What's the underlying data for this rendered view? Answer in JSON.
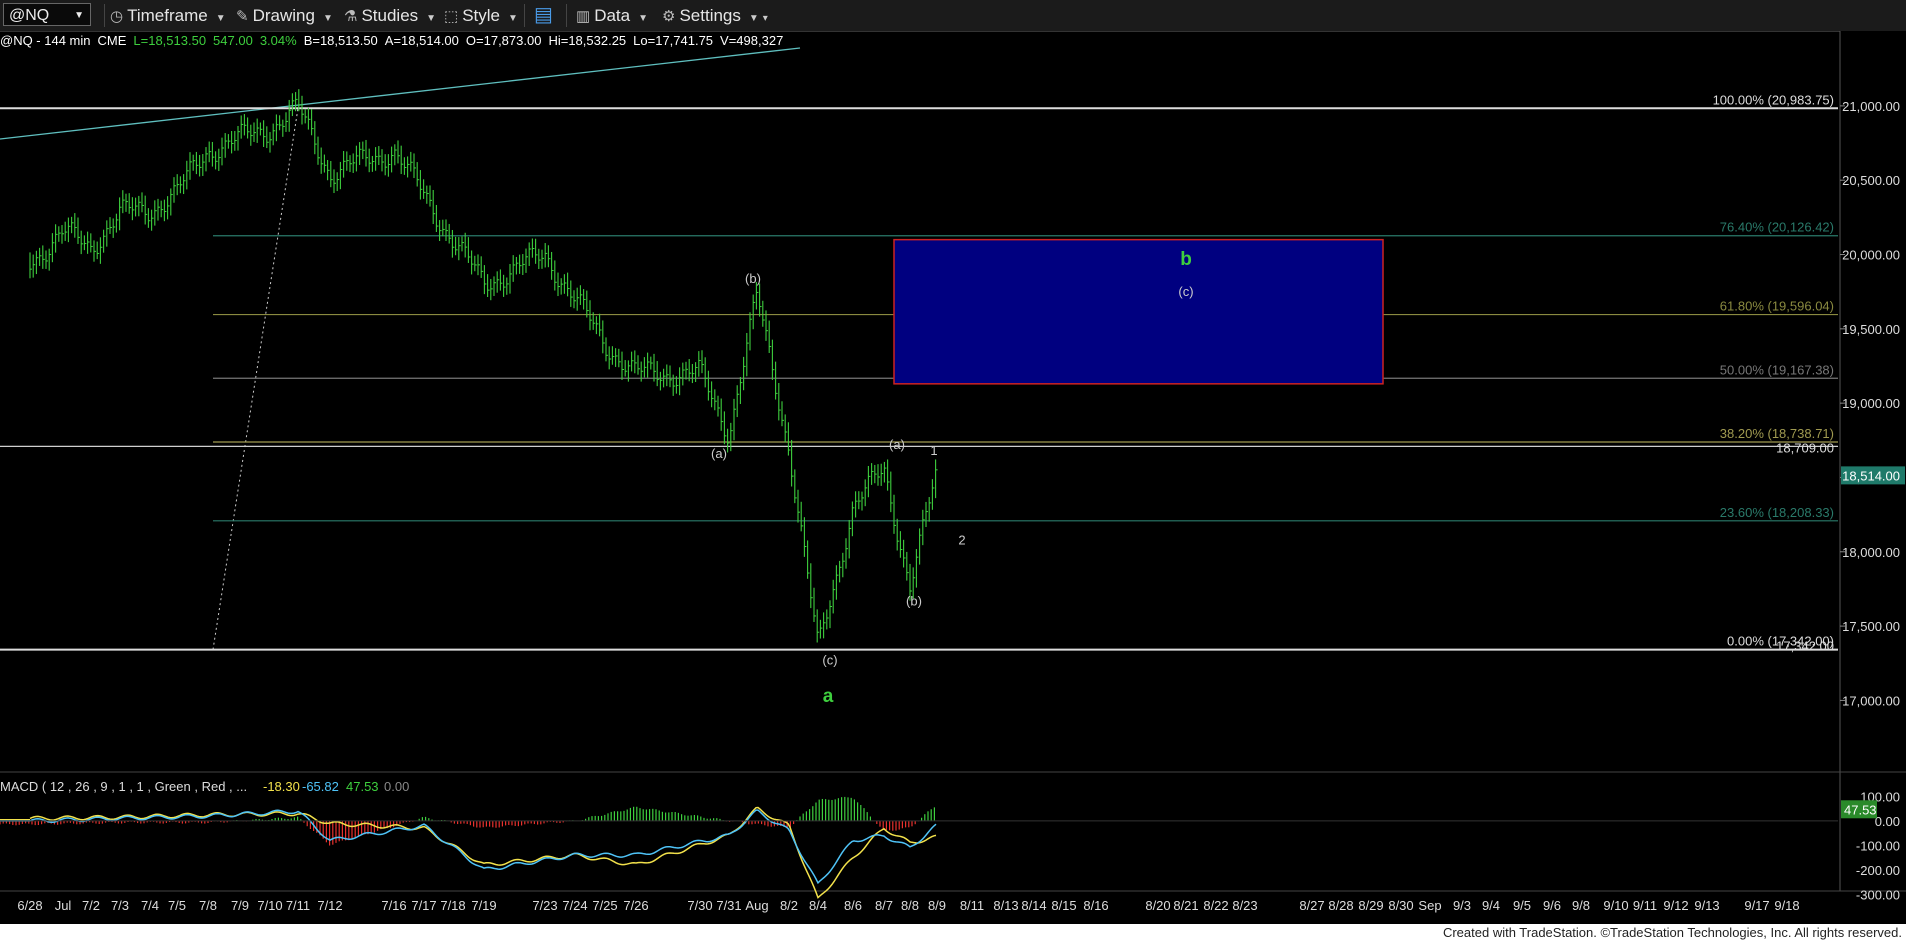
{
  "toolbar": {
    "symbol": "@NQ",
    "timeframe": "Timeframe",
    "drawing": "Drawing",
    "studies": "Studies",
    "style": "Style",
    "data": "Data",
    "settings": "Settings"
  },
  "info": {
    "symbol_line": "@NQ - 144 min",
    "exchange": "CME",
    "last": "L=18,513.50",
    "change": "547.00",
    "change_pct": "3.04%",
    "bid": "B=18,513.50",
    "ask": "A=18,514.00",
    "open": "O=17,873.00",
    "high": "Hi=18,532.25",
    "low": "Lo=17,741.75",
    "volume": "V=498,327"
  },
  "footer": "Created with TradeStation. ©TradeStation Technologies, Inc. All rights reserved.",
  "colors": {
    "up": "#3ecf3e",
    "down": "#e8312e",
    "macd_line": "#4fc3f7",
    "signal_line": "#f2e14b",
    "target_box": "#000080",
    "target_border": "#cc2222",
    "trendline": "#5fbfbf",
    "price_badge": "#1f7a6a"
  },
  "chart_data": [
    {
      "type": "candlestick",
      "timeframe": "144 min",
      "x_tick_labels": [
        "6/28",
        "Jul",
        "7/2",
        "7/3",
        "7/4",
        "7/5",
        "7/8",
        "7/9",
        "7/10",
        "7/11",
        "7/12",
        "7/16",
        "7/17",
        "7/18",
        "7/19",
        "7/23",
        "7/24",
        "7/25",
        "7/26",
        "7/30",
        "7/31",
        "Aug",
        "8/2",
        "8/4",
        "8/6",
        "8/7",
        "8/8",
        "8/9",
        "8/11",
        "8/13",
        "8/14",
        "8/15",
        "8/16",
        "8/20",
        "8/21",
        "8/22",
        "8/23",
        "8/27",
        "8/28",
        "8/29",
        "8/30",
        "Sep",
        "9/3",
        "9/4",
        "9/5",
        "9/6",
        "9/8",
        "9/10",
        "9/11",
        "9/12",
        "9/13",
        "9/17",
        "9/18"
      ],
      "ylim": [
        16700,
        21450
      ],
      "y_ticks": [
        "17,000.00",
        "17,500.00",
        "18,000.00",
        "18,500.00",
        "19,000.00",
        "19,500.00",
        "20,000.00",
        "20,500.00",
        "21,000.00"
      ],
      "last_price_label": "18,514.00",
      "horizontal_line_label": "18,709.00",
      "low_label": "17,342.00",
      "path_points": [
        [
          "6/28",
          19950
        ],
        [
          "Jul",
          20150
        ],
        [
          "7/2",
          20050
        ],
        [
          "7/3",
          20280
        ],
        [
          "7/4",
          20300
        ],
        [
          "7/5",
          20420
        ],
        [
          "7/8",
          20700
        ],
        [
          "7/9",
          20780
        ],
        [
          "7/10",
          20850
        ],
        [
          "7/11",
          20984
        ],
        [
          "7/12",
          20550
        ],
        [
          "7/16",
          20700
        ],
        [
          "7/17",
          20400
        ],
        [
          "7/18",
          20100
        ],
        [
          "7/19",
          19800
        ],
        [
          "7/23",
          20000
        ],
        [
          "7/24",
          19700
        ],
        [
          "7/25",
          19400
        ],
        [
          "7/26",
          19200
        ],
        [
          "7/30",
          19200
        ],
        [
          "7/31",
          18800
        ],
        [
          "Aug",
          19720
        ],
        [
          "8/2",
          18700
        ],
        [
          "8/4",
          17342
        ],
        [
          "8/6",
          18300
        ],
        [
          "8/7",
          18550
        ],
        [
          "8/8",
          17780
        ],
        [
          "8/9",
          18530
        ]
      ],
      "fibonacci": [
        {
          "label": "100.00% (20,983.75)",
          "value": 20983.75
        },
        {
          "label": "76.40% (20,126.42)",
          "value": 20126.42
        },
        {
          "label": "61.80% (19,596.04)",
          "value": 19596.04
        },
        {
          "label": "50.00% (19,167.38)",
          "value": 19167.38
        },
        {
          "label": "38.20% (18,738.71)",
          "value": 18738.71
        },
        {
          "label": "23.60% (18,208.33)",
          "value": 18208.33
        },
        {
          "label": "0.00% (17,342.00)",
          "value": 17342.0
        }
      ],
      "target_box": {
        "from_date": "8/13",
        "to_date": "8/30",
        "top": 20100,
        "bottom": 19130
      },
      "annotations": [
        {
          "text": "(b)",
          "date": "Aug",
          "value": 19810
        },
        {
          "text": "(a)",
          "date": "7/31",
          "value": 18630
        },
        {
          "text": "(a)",
          "date": "8/7",
          "value": 18690
        },
        {
          "text": "1",
          "date": "8/8",
          "value": 18650
        },
        {
          "text": "2",
          "date": "8/9",
          "value": 18050
        },
        {
          "text": "(b)",
          "date": "8/8",
          "value": 17640
        },
        {
          "text": "(c)",
          "date": "8/4",
          "value": 17240
        },
        {
          "text": "a",
          "date": "8/4",
          "value": 16990,
          "color": "green"
        },
        {
          "text": "b",
          "date": "8/21",
          "value": 19930,
          "color": "green"
        },
        {
          "text": "(c)",
          "date": "8/21",
          "value": 19720
        }
      ]
    },
    {
      "type": "bar",
      "title": "MACD ( 12 , 26 , 9 , 1 , 1 , Green , Red , ...",
      "values_text": [
        "-18.30",
        "-65.82",
        "47.53",
        "0.00"
      ],
      "ylim": [
        -360,
        110
      ],
      "y_ticks": [
        "100.00",
        "0.00",
        "-100.00",
        "-200.00",
        "-300.00"
      ],
      "last_value_label": "47.53",
      "macd_points": [
        [
          "6/28",
          0
        ],
        [
          "7/3",
          10
        ],
        [
          "7/8",
          20
        ],
        [
          "7/11",
          40
        ],
        [
          "7/12",
          -80
        ],
        [
          "7/17",
          -20
        ],
        [
          "7/19",
          -200
        ],
        [
          "7/24",
          -140
        ],
        [
          "7/26",
          -140
        ],
        [
          "7/31",
          -60
        ],
        [
          "Aug",
          40
        ],
        [
          "8/2",
          -40
        ],
        [
          "8/4",
          -260
        ],
        [
          "8/6",
          -80
        ],
        [
          "8/7",
          -60
        ],
        [
          "8/8",
          -110
        ],
        [
          "8/9",
          -18
        ]
      ],
      "signal_points": [
        [
          "6/28",
          10
        ],
        [
          "7/3",
          15
        ],
        [
          "7/8",
          25
        ],
        [
          "7/11",
          30
        ],
        [
          "7/12",
          -10
        ],
        [
          "7/17",
          -30
        ],
        [
          "7/19",
          -180
        ],
        [
          "7/24",
          -140
        ],
        [
          "7/26",
          -180
        ],
        [
          "7/31",
          -60
        ],
        [
          "Aug",
          50
        ],
        [
          "8/2",
          -20
        ],
        [
          "8/4",
          -320
        ],
        [
          "8/6",
          -150
        ],
        [
          "8/7",
          -30
        ],
        [
          "8/8",
          -90
        ],
        [
          "8/9",
          -66
        ]
      ]
    }
  ]
}
